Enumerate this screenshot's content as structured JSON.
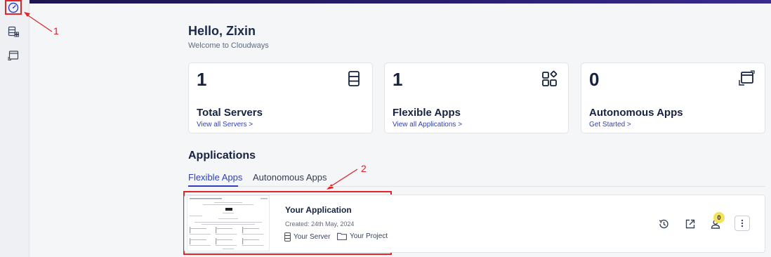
{
  "header": {
    "greeting": "Hello, Zixin",
    "subtitle": "Welcome to Cloudways"
  },
  "sidebar": {
    "items": [
      {
        "name": "dashboard",
        "icon": "gauge-icon"
      },
      {
        "name": "servers",
        "icon": "server-grid-icon"
      },
      {
        "name": "applications",
        "icon": "window-icon"
      }
    ]
  },
  "stats": [
    {
      "count": "1",
      "label": "Total Servers",
      "link": "View all Servers >",
      "icon": "server-icon"
    },
    {
      "count": "1",
      "label": "Flexible Apps",
      "link": "View all Applications >",
      "icon": "apps-grid-icon"
    },
    {
      "count": "0",
      "label": "Autonomous Apps",
      "link": "Get Started >",
      "icon": "autonomous-window-icon"
    }
  ],
  "applications": {
    "title": "Applications",
    "tabs": [
      {
        "label": "Flexible Apps",
        "active": true
      },
      {
        "label": "Autonomous Apps",
        "active": false
      }
    ],
    "app": {
      "name": "Your Application",
      "created": "Created: 24th May, 2024",
      "server": "Your Server",
      "project": "Your Project",
      "team_count": "0"
    }
  },
  "annotations": {
    "label_1": "1",
    "label_2": "2"
  },
  "colors": {
    "accent": "#2f3fbf",
    "annotation": "#e0262b",
    "topbar": "#2a1d6e",
    "badge": "#f4e25a"
  }
}
